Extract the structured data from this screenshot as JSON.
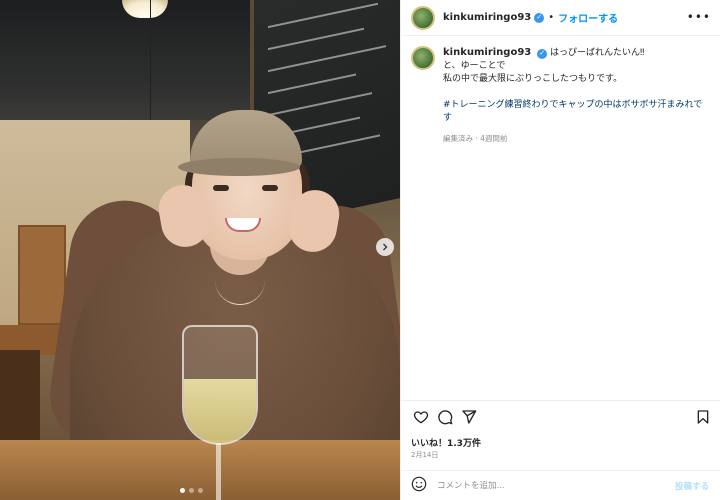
{
  "post": {
    "header": {
      "username": "kinkumiringo93",
      "separator": "•",
      "follow_label": "フォローする",
      "more_label": "•••"
    },
    "caption": {
      "username": "kinkumiringo93",
      "lines": [
        "はっぴーばれんたいん‼︎",
        "と、ゆーことで",
        "私の中で最大限にぶりっこしたつもりです。"
      ],
      "hashtag": "#トレーニング練習終わりでキャップの中はボサボサ汗まみれです",
      "meta": "編集済み · 4週間前"
    },
    "actions": {
      "like_icon": "heart-icon",
      "comment_icon": "comment-icon",
      "share_icon": "share-icon",
      "save_icon": "bookmark-icon"
    },
    "likes_text": "いいね！1.3万件",
    "date_text": "2月14日",
    "comment": {
      "emoji_icon": "emoji-icon",
      "placeholder": "コメントを追加...",
      "post_label": "投稿する"
    },
    "carousel": {
      "next_icon": "chevron-right-icon",
      "total": 3,
      "active_index": 0
    }
  },
  "colors": {
    "accent": "#0095f6",
    "verified": "#3897f0",
    "hashtag": "#00376b",
    "muted": "#8e8e8e"
  }
}
